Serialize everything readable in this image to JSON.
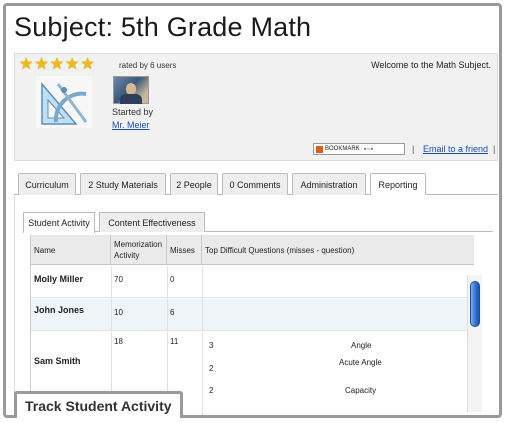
{
  "subject": {
    "title": "Subject: 5th Grade Math",
    "rating_stars": 5,
    "rated_text": "rated by 6 users",
    "welcome": "Welcome to the Math Subject.",
    "started_by_label": "Started by",
    "teacher": "Mr. Meier",
    "bookmark_label": "BOOKMARK",
    "email_link": "Email to a friend",
    "separator": "|"
  },
  "main_tabs": [
    {
      "label": "Curriculum"
    },
    {
      "label": "2 Study Materials"
    },
    {
      "label": "2 People"
    },
    {
      "label": "0 Comments"
    },
    {
      "label": "Administration"
    },
    {
      "label": "Reporting",
      "active": true
    }
  ],
  "sub_tabs": [
    {
      "label": "Student Activity",
      "active": true
    },
    {
      "label": "Content Effectiveness"
    }
  ],
  "table": {
    "headers": [
      "Name",
      "Memorization Activity",
      "Misses",
      "Top Difficult Questions (misses - question)"
    ],
    "rows": [
      {
        "name": "Molly Miller",
        "activity": "70",
        "misses": "0",
        "questions": []
      },
      {
        "name": "John Jones",
        "activity": "10",
        "misses": "6",
        "questions": []
      },
      {
        "name": "Sam Smith",
        "activity": "18",
        "misses": "11",
        "questions": [
          {
            "misses": "3",
            "question": "Angle"
          },
          {
            "misses": "2",
            "question": "Acute Angle"
          },
          {
            "misses": "2",
            "question": "Capacity"
          }
        ]
      }
    ]
  },
  "caption": "Track Student Activity",
  "colors": {
    "star": "#f2b90e",
    "link": "#1a4fb0",
    "scrollbar": "#2f6fcf",
    "alt_row": "#eef5f8"
  }
}
